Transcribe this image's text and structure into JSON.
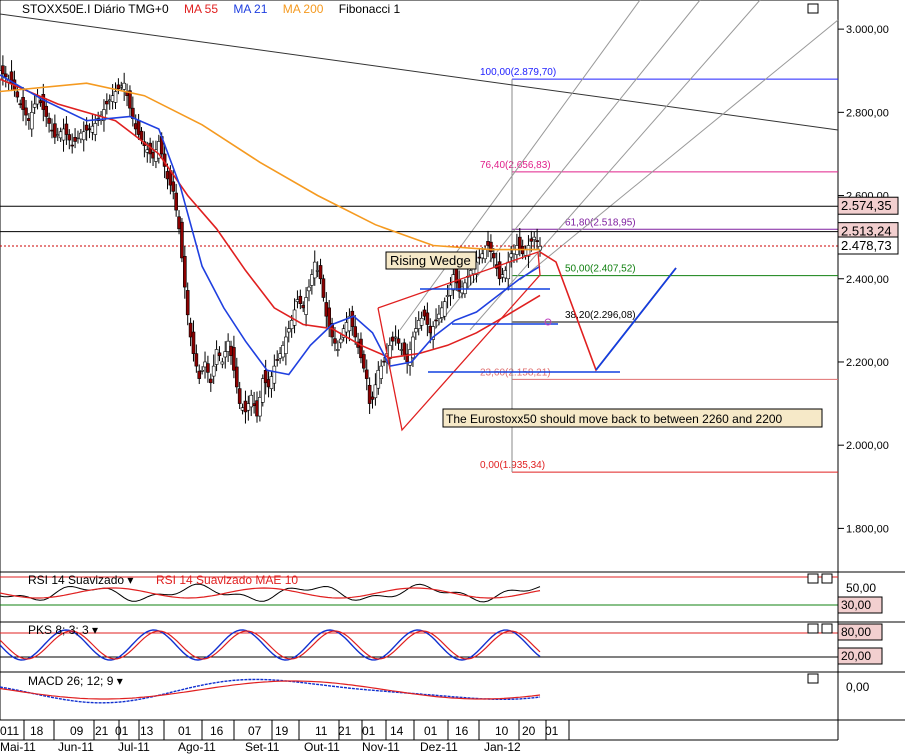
{
  "header": {
    "symbol": "STOXX50E.I Diário TMG+0",
    "indicators": [
      {
        "label": "MA 55",
        "color": "#e02020"
      },
      {
        "label": "MA 21",
        "color": "#2040e0"
      },
      {
        "label": "MA 200",
        "color": "#f59a20"
      },
      {
        "label": "Fibonacci 1",
        "color": "#000000"
      }
    ]
  },
  "colors": {
    "up": "#ffffff",
    "down": "#8b0000",
    "ma55": "#e02020",
    "ma21": "#2040e0",
    "ma200": "#f59a20",
    "annotation": "#e02020",
    "forecast": "#1040e0",
    "grid": "#000000"
  },
  "chart_data": [
    {
      "type": "candlestick",
      "title": "STOXX50E.I Diário TMG+0",
      "ylim": [
        1700,
        3070
      ],
      "yticks": [
        1800,
        2000,
        2200,
        2400,
        2600,
        2800,
        3000
      ],
      "ytick_labels": [
        "1.800,00",
        "2.000,00",
        "2.200,00",
        "2.400,00",
        "2.600,00",
        "2.800,00",
        "3.000,00"
      ],
      "price_labels": [
        {
          "value": 2574.35,
          "text": "2.574,35"
        },
        {
          "value": 2513.24,
          "text": "2.513,24"
        },
        {
          "value": 2478.73,
          "text": "2.478,73"
        }
      ],
      "close_path": [
        [
          0,
          2900
        ],
        [
          8,
          2870
        ],
        [
          14,
          2820
        ],
        [
          20,
          2780
        ],
        [
          26,
          2840
        ],
        [
          32,
          2790
        ],
        [
          38,
          2740
        ],
        [
          44,
          2760
        ],
        [
          50,
          2720
        ],
        [
          56,
          2750
        ],
        [
          62,
          2760
        ],
        [
          68,
          2780
        ],
        [
          74,
          2820
        ],
        [
          80,
          2850
        ],
        [
          86,
          2870
        ],
        [
          90,
          2810
        ],
        [
          94,
          2760
        ],
        [
          100,
          2720
        ],
        [
          106,
          2690
        ],
        [
          110,
          2730
        ],
        [
          116,
          2640
        ],
        [
          120,
          2610
        ],
        [
          124,
          2520
        ],
        [
          128,
          2380
        ],
        [
          131,
          2280
        ],
        [
          134,
          2220
        ],
        [
          138,
          2160
        ],
        [
          142,
          2200
        ],
        [
          146,
          2150
        ],
        [
          150,
          2230
        ],
        [
          154,
          2200
        ],
        [
          158,
          2250
        ],
        [
          162,
          2180
        ],
        [
          166,
          2100
        ],
        [
          170,
          2080
        ],
        [
          174,
          2120
        ],
        [
          178,
          2070
        ],
        [
          182,
          2160
        ],
        [
          186,
          2140
        ],
        [
          190,
          2190
        ],
        [
          194,
          2220
        ],
        [
          198,
          2260
        ],
        [
          202,
          2300
        ],
        [
          206,
          2350
        ],
        [
          210,
          2330
        ],
        [
          214,
          2380
        ],
        [
          218,
          2440
        ],
        [
          222,
          2400
        ],
        [
          226,
          2310
        ],
        [
          230,
          2260
        ],
        [
          234,
          2230
        ],
        [
          238,
          2280
        ],
        [
          242,
          2310
        ],
        [
          246,
          2260
        ],
        [
          250,
          2210
        ],
        [
          254,
          2160
        ],
        [
          256,
          2100
        ],
        [
          258,
          2110
        ],
        [
          262,
          2180
        ],
        [
          266,
          2200
        ],
        [
          270,
          2240
        ],
        [
          274,
          2260
        ],
        [
          278,
          2230
        ],
        [
          282,
          2200
        ],
        [
          286,
          2260
        ],
        [
          290,
          2300
        ],
        [
          294,
          2310
        ],
        [
          298,
          2270
        ],
        [
          302,
          2300
        ],
        [
          306,
          2330
        ],
        [
          310,
          2360
        ],
        [
          314,
          2410
        ],
        [
          318,
          2370
        ],
        [
          322,
          2390
        ],
        [
          326,
          2420
        ],
        [
          330,
          2440
        ],
        [
          334,
          2460
        ],
        [
          338,
          2480
        ],
        [
          342,
          2450
        ],
        [
          346,
          2400
        ],
        [
          350,
          2420
        ],
        [
          354,
          2460
        ],
        [
          358,
          2480
        ],
        [
          362,
          2460
        ],
        [
          366,
          2480
        ],
        [
          370,
          2500
        ],
        [
          374,
          2478
        ]
      ],
      "x_start": 0,
      "x_end": 374,
      "x_domain": [
        0,
        374
      ],
      "series": [
        {
          "name": "MA 55",
          "points": [
            [
              0,
              2880
            ],
            [
              40,
              2820
            ],
            [
              80,
              2780
            ],
            [
              110,
              2700
            ],
            [
              130,
              2600
            ],
            [
              150,
              2520
            ],
            [
              170,
              2420
            ],
            [
              190,
              2330
            ],
            [
              210,
              2290
            ],
            [
              230,
              2280
            ],
            [
              250,
              2240
            ],
            [
              270,
              2210
            ],
            [
              290,
              2220
            ],
            [
              310,
              2240
            ],
            [
              330,
              2270
            ],
            [
              350,
              2310
            ],
            [
              374,
              2360
            ]
          ]
        },
        {
          "name": "MA 21",
          "points": [
            [
              0,
              2890
            ],
            [
              30,
              2830
            ],
            [
              60,
              2780
            ],
            [
              90,
              2790
            ],
            [
              110,
              2760
            ],
            [
              125,
              2620
            ],
            [
              140,
              2430
            ],
            [
              155,
              2330
            ],
            [
              170,
              2250
            ],
            [
              185,
              2180
            ],
            [
              200,
              2170
            ],
            [
              215,
              2240
            ],
            [
              230,
              2290
            ],
            [
              245,
              2310
            ],
            [
              258,
              2270
            ],
            [
              270,
              2190
            ],
            [
              285,
              2200
            ],
            [
              300,
              2260
            ],
            [
              315,
              2300
            ],
            [
              330,
              2320
            ],
            [
              345,
              2360
            ],
            [
              360,
              2400
            ],
            [
              374,
              2430
            ]
          ]
        },
        {
          "name": "MA 200",
          "points": [
            [
              0,
              2850
            ],
            [
              60,
              2870
            ],
            [
              100,
              2840
            ],
            [
              140,
              2770
            ],
            [
              180,
              2680
            ],
            [
              220,
              2600
            ],
            [
              260,
              2530
            ],
            [
              300,
              2480
            ],
            [
              340,
              2470
            ],
            [
              374,
              2470
            ]
          ]
        }
      ],
      "fibonacci": [
        {
          "level": 2879.7,
          "text": "100,00(2.879,70)",
          "color": "#2020ff"
        },
        {
          "level": 2656.83,
          "text": "76,40(2.656,83)",
          "color": "#e0208a"
        },
        {
          "level": 2518.95,
          "text": "61,80(2.518,95)",
          "color": "#8020a0"
        },
        {
          "level": 2407.52,
          "text": "50,00(2.407,52)",
          "color": "#108010"
        },
        {
          "level": 2296.08,
          "text": "38,20(2.296,08)",
          "color": "#000000"
        },
        {
          "level": 2158.21,
          "text": "23,60(2.158,21)",
          "color": "#e07070"
        },
        {
          "level": 1935.34,
          "text": "0,00(1.935,34)",
          "color": "#e02020"
        }
      ],
      "annotations": {
        "pattern_label": "Rising Wedge",
        "forecast_label": "The Eurostoxx50 should move back to between 2260 and 2200"
      },
      "xtick_days": [
        "011",
        "18",
        "09",
        "21",
        "01",
        "13",
        "01",
        "16",
        "07",
        "19",
        "11",
        "21",
        "01",
        "14",
        "01",
        "16",
        "10",
        "20",
        "01"
      ],
      "xtick_months": [
        "Mai-11",
        "Jun-11",
        "Jul-11",
        "Ago-11",
        "Set-11",
        "Out-11",
        "Nov-11",
        "Dez-11",
        "Jan-12"
      ]
    },
    {
      "type": "line",
      "title": "RSI 14 Suavizado",
      "series": [
        {
          "name": "RSI 14 Suavizado",
          "color": "#000000"
        },
        {
          "name": "RSI 14 Suavizado MAE 10",
          "color": "#e02020"
        }
      ],
      "ytick_labels": [
        "50,00",
        "30,00"
      ]
    },
    {
      "type": "line",
      "title": "PKS 8; 3; 3",
      "ytick_labels": [
        "80,00",
        "20,00"
      ]
    },
    {
      "type": "line",
      "title": "MACD 26; 12; 9",
      "ytick_labels": [
        "0,00"
      ]
    }
  ]
}
